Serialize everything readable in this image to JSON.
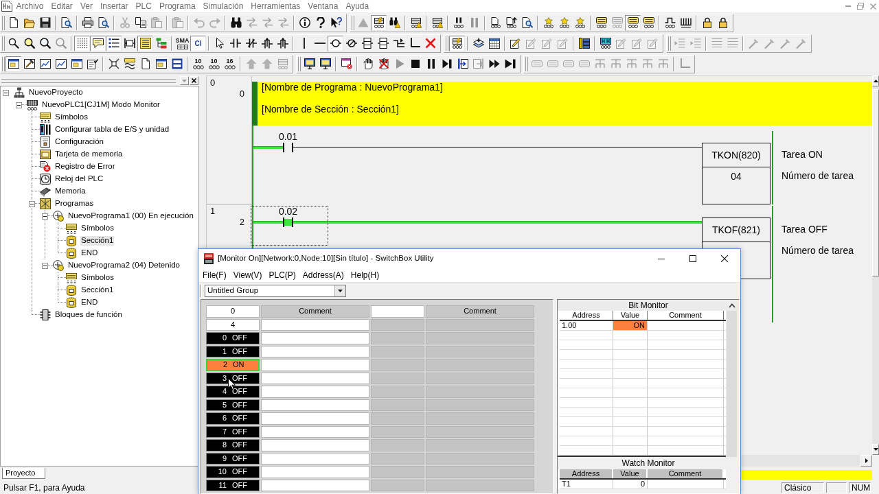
{
  "menu": [
    "Archivo",
    "Editar",
    "Ver",
    "Insertar",
    "PLC",
    "Programa",
    "Simulación",
    "Herramientas",
    "Ventana",
    "Ayuda"
  ],
  "toolbars": [
    [
      [
        [
          {
            "kind": "new",
            "disabled": false,
            "pressed": false
          },
          {
            "kind": "open",
            "disabled": false,
            "pressed": false
          },
          {
            "kind": "save",
            "disabled": false,
            "pressed": false
          }
        ],
        [
          {
            "kind": "finddoc",
            "disabled": false,
            "pressed": false
          }
        ],
        [
          {
            "kind": "print",
            "disabled": false,
            "pressed": false
          },
          {
            "kind": "finddoc",
            "disabled": false,
            "pressed": false
          }
        ],
        [
          {
            "kind": "cut",
            "disabled": true,
            "pressed": false
          },
          {
            "kind": "copy",
            "disabled": false,
            "pressed": false
          },
          {
            "kind": "paste",
            "disabled": true,
            "pressed": false
          }
        ],
        [
          {
            "kind": "paste",
            "disabled": true,
            "pressed": false
          }
        ],
        [
          {
            "kind": "undo",
            "disabled": true,
            "pressed": false
          },
          {
            "kind": "redo",
            "disabled": true,
            "pressed": false
          }
        ],
        [
          {
            "kind": "binoc",
            "disabled": false,
            "pressed": false
          },
          {
            "kind": "swap",
            "disabled": true,
            "pressed": false
          },
          {
            "kind": "swap",
            "disabled": true,
            "pressed": false
          },
          {
            "kind": "swap",
            "disabled": true,
            "pressed": false
          }
        ],
        [
          {
            "kind": "info",
            "disabled": false,
            "pressed": false
          },
          {
            "kind": "help",
            "disabled": false,
            "pressed": false
          },
          {
            "kind": "whats",
            "disabled": false,
            "pressed": false
          }
        ]
      ],
      [
        [
          {
            "kind": "tri",
            "disabled": true,
            "pressed": false
          },
          {
            "kind": "plcbolt",
            "disabled": false,
            "pressed": true
          },
          {
            "kind": "binwarn",
            "disabled": false,
            "pressed": false
          }
        ],
        [
          {
            "kind": "plcwarn",
            "disabled": false,
            "pressed": false
          }
        ],
        [
          {
            "kind": "plcwarn",
            "disabled": false,
            "pressed": false
          }
        ],
        [
          {
            "kind": "plcpause",
            "disabled": false,
            "pressed": false
          },
          {
            "kind": "pause",
            "disabled": true,
            "pressed": false
          }
        ],
        [
          {
            "kind": "plcdoc",
            "disabled": false,
            "pressed": false
          },
          {
            "kind": "upload",
            "disabled": false,
            "pressed": false
          },
          {
            "kind": "finddoc",
            "disabled": false,
            "pressed": false
          }
        ],
        [
          {
            "kind": "spark",
            "disabled": false,
            "pressed": false
          },
          {
            "kind": "spark",
            "disabled": false,
            "pressed": false
          },
          {
            "kind": "spark",
            "disabled": false,
            "pressed": false
          }
        ],
        [
          {
            "kind": "mon",
            "disabled": false,
            "pressed": false
          },
          {
            "kind": "mon",
            "disabled": true,
            "pressed": false
          },
          {
            "kind": "mon",
            "disabled": false,
            "pressed": true
          },
          {
            "kind": "mon",
            "disabled": false,
            "pressed": false
          }
        ],
        [
          {
            "kind": "wave",
            "disabled": false,
            "pressed": false
          },
          {
            "kind": "comb",
            "disabled": false,
            "pressed": false
          }
        ],
        [
          {
            "kind": "lock",
            "disabled": false,
            "pressed": false
          },
          {
            "kind": "lock",
            "disabled": false,
            "pressed": false
          }
        ]
      ]
    ],
    [
      [
        [
          {
            "kind": "magsm",
            "disabled": false,
            "pressed": false
          },
          {
            "kind": "magy",
            "disabled": false,
            "pressed": false
          },
          {
            "kind": "mag",
            "disabled": false,
            "pressed": false
          },
          {
            "kind": "mag",
            "disabled": true,
            "pressed": false
          }
        ],
        [
          {
            "kind": "grid",
            "disabled": false,
            "pressed": true
          },
          {
            "kind": "bubble",
            "disabled": false,
            "pressed": true
          },
          {
            "kind": "list",
            "disabled": false,
            "pressed": true
          },
          {
            "kind": "bracket",
            "disabled": false,
            "pressed": false
          },
          {
            "kind": "sheet",
            "disabled": false,
            "pressed": true
          },
          {
            "kind": "tree",
            "disabled": false,
            "pressed": false
          }
        ],
        [
          {
            "kind": "sma",
            "label": "SMA",
            "disabled": false,
            "pressed": false
          },
          {
            "kind": "ci",
            "label": "CI",
            "disabled": false,
            "pressed": true
          }
        ],
        [
          {
            "kind": "pointer",
            "disabled": false,
            "pressed": false
          },
          {
            "kind": "no",
            "disabled": false,
            "pressed": false
          },
          {
            "kind": "nc",
            "disabled": false,
            "pressed": false
          },
          {
            "kind": "edge",
            "disabled": false,
            "pressed": false
          },
          {
            "kind": "edge",
            "disabled": false,
            "pressed": false
          }
        ],
        [
          {
            "kind": "vline",
            "disabled": false,
            "pressed": false
          },
          {
            "kind": "hline",
            "disabled": false,
            "pressed": false
          },
          {
            "kind": "coil",
            "disabled": false,
            "pressed": true
          },
          {
            "kind": "coilnc",
            "disabled": false,
            "pressed": false
          },
          {
            "kind": "instr",
            "disabled": false,
            "pressed": false
          },
          {
            "kind": "instr",
            "disabled": false,
            "pressed": false
          },
          {
            "kind": "branch",
            "disabled": false,
            "pressed": false
          },
          {
            "kind": "corner",
            "disabled": false,
            "pressed": false
          },
          {
            "kind": "del",
            "disabled": false,
            "pressed": false
          }
        ]
      ],
      [
        [
          {
            "kind": "plcbolt",
            "disabled": false,
            "pressed": true
          }
        ],
        [
          {
            "kind": "layers",
            "disabled": false,
            "pressed": false
          },
          {
            "kind": "cal",
            "disabled": false,
            "pressed": false
          }
        ],
        [
          {
            "kind": "editbox",
            "disabled": false,
            "pressed": false
          },
          {
            "kind": "editbox",
            "disabled": true,
            "pressed": false
          },
          {
            "kind": "editbox",
            "disabled": true,
            "pressed": false
          },
          {
            "kind": "editbox",
            "disabled": true,
            "pressed": false
          }
        ],
        [
          {
            "kind": "cols",
            "disabled": false,
            "pressed": false
          }
        ],
        [
          {
            "kind": "hhplc",
            "disabled": false,
            "pressed": false
          },
          {
            "kind": "editbox",
            "disabled": true,
            "pressed": false
          },
          {
            "kind": "editbox",
            "disabled": true,
            "pressed": false
          },
          {
            "kind": "editbox",
            "disabled": true,
            "pressed": false
          }
        ]
      ],
      [
        [
          {
            "kind": "indent",
            "disabled": true,
            "pressed": false
          },
          {
            "kind": "indent",
            "disabled": true,
            "pressed": false
          }
        ],
        [
          {
            "kind": "align",
            "disabled": true,
            "pressed": false
          },
          {
            "kind": "align",
            "disabled": true,
            "pressed": false
          }
        ],
        [
          {
            "kind": "wand",
            "disabled": true,
            "pressed": false
          },
          {
            "kind": "wand",
            "disabled": true,
            "pressed": false
          },
          {
            "kind": "wand",
            "disabled": true,
            "pressed": false
          },
          {
            "kind": "wand",
            "disabled": true,
            "pressed": false
          }
        ]
      ]
    ],
    [
      [
        [
          {
            "kind": "win",
            "disabled": false,
            "pressed": true
          },
          {
            "kind": "hammer",
            "disabled": false,
            "pressed": false
          },
          {
            "kind": "chartwin",
            "disabled": false,
            "pressed": false
          },
          {
            "kind": "chartwin",
            "disabled": false,
            "pressed": false
          },
          {
            "kind": "win",
            "disabled": false,
            "pressed": false
          },
          {
            "kind": "props",
            "disabled": false,
            "pressed": false
          }
        ],
        [
          {
            "kind": "crossarr",
            "disabled": false,
            "pressed": false
          },
          {
            "kind": "cable",
            "disabled": false,
            "pressed": false
          },
          {
            "kind": "new",
            "disabled": false,
            "pressed": false
          },
          {
            "kind": "win",
            "disabled": false,
            "pressed": false
          },
          {
            "kind": "memtab",
            "disabled": false,
            "pressed": false
          }
        ],
        [
          {
            "kind": "radix",
            "label": "10",
            "disabled": false,
            "pressed": false
          },
          {
            "kind": "radix",
            "label": "10",
            "disabled": false,
            "pressed": false
          },
          {
            "kind": "radix",
            "label": "16",
            "disabled": false,
            "pressed": false
          }
        ],
        [
          {
            "kind": "arrowup",
            "disabled": true,
            "pressed": false
          },
          {
            "kind": "arrowup",
            "disabled": true,
            "pressed": false
          },
          {
            "kind": "plc",
            "disabled": true,
            "pressed": false
          }
        ]
      ],
      [
        [
          {
            "kind": "screen",
            "disabled": false,
            "pressed": false
          },
          {
            "kind": "screen",
            "disabled": false,
            "pressed": false
          }
        ],
        [
          {
            "kind": "windel",
            "disabled": false,
            "pressed": false
          }
        ],
        [
          {
            "kind": "hand",
            "disabled": false,
            "pressed": false
          },
          {
            "kind": "handx",
            "disabled": false,
            "pressed": false
          },
          {
            "kind": "play",
            "disabled": true,
            "pressed": false
          },
          {
            "kind": "stop",
            "disabled": false,
            "pressed": false
          },
          {
            "kind": "pause",
            "disabled": false,
            "pressed": false
          },
          {
            "kind": "step",
            "disabled": false,
            "pressed": false
          },
          {
            "kind": "stepin",
            "disabled": false,
            "pressed": false
          },
          {
            "kind": "stepout",
            "disabled": true,
            "pressed": false
          },
          {
            "kind": "ff",
            "disabled": false,
            "pressed": false
          },
          {
            "kind": "end",
            "disabled": false,
            "pressed": false
          }
        ]
      ],
      [
        [
          {
            "kind": "block",
            "disabled": true,
            "pressed": false
          },
          {
            "kind": "block",
            "disabled": true,
            "pressed": false
          },
          {
            "kind": "block",
            "disabled": true,
            "pressed": false
          },
          {
            "kind": "block",
            "disabled": true,
            "pressed": false
          },
          {
            "kind": "bus",
            "disabled": true,
            "pressed": false
          },
          {
            "kind": "bus",
            "disabled": true,
            "pressed": false
          },
          {
            "kind": "bus",
            "disabled": true,
            "pressed": false
          },
          {
            "kind": "bus",
            "disabled": true,
            "pressed": false
          },
          {
            "kind": "bus",
            "disabled": true,
            "pressed": false
          }
        ],
        [
          {
            "kind": "corner",
            "disabled": true,
            "pressed": false
          }
        ]
      ]
    ]
  ],
  "project_tree": {
    "nodes": [
      {
        "label": "NuevoProyecto",
        "kind": "project",
        "expanded": true,
        "selected": false,
        "children": [
          {
            "label": "NuevoPLC1[CJ1M] Modo Monitor",
            "kind": "plc",
            "expanded": true,
            "selected": false,
            "children": [
              {
                "label": "Símbolos",
                "kind": "symbols",
                "selected": false
              },
              {
                "label": "Configurar tabla de E/S y unidad",
                "kind": "io",
                "selected": false
              },
              {
                "label": "Configuración",
                "kind": "settings",
                "selected": false
              },
              {
                "label": "Tarjeta de memoria",
                "kind": "card",
                "selected": false
              },
              {
                "label": "Registro de Error",
                "kind": "errors",
                "selected": false
              },
              {
                "label": "Reloj del PLC",
                "kind": "clock",
                "selected": false
              },
              {
                "label": "Memoria",
                "kind": "memory",
                "selected": false
              },
              {
                "label": "Programas",
                "kind": "programs",
                "expanded": true,
                "selected": false,
                "children": [
                  {
                    "label": "NuevoPrograma1 (00) En ejecución",
                    "kind": "program",
                    "expanded": true,
                    "selected": false,
                    "children": [
                      {
                        "label": "Símbolos",
                        "kind": "symbols",
                        "selected": false
                      },
                      {
                        "label": "Sección1",
                        "kind": "section",
                        "selected": true
                      },
                      {
                        "label": "END",
                        "kind": "section",
                        "selected": false
                      }
                    ]
                  },
                  {
                    "label": "NuevoPrograma2 (04) Detenido",
                    "kind": "program",
                    "expanded": true,
                    "selected": false,
                    "children": [
                      {
                        "label": "Símbolos",
                        "kind": "symbols",
                        "selected": false
                      },
                      {
                        "label": "Sección1",
                        "kind": "section",
                        "selected": false
                      },
                      {
                        "label": "END",
                        "kind": "section",
                        "selected": false
                      }
                    ]
                  }
                ]
              },
              {
                "label": "Bloques de función",
                "kind": "fblocks",
                "selected": false
              }
            ]
          }
        ]
      }
    ],
    "tab": "Proyecto"
  },
  "ladder": {
    "rungs": [
      {
        "rung": "0",
        "step": "0",
        "comment": [
          "[Nombre de Programa : NuevoPrograma1]",
          "[Nombre de Sección : Sección1]"
        ],
        "selected": false,
        "contact": {
          "address": "0.01",
          "on": false
        },
        "instruction": {
          "mnemonic": "TKON(820)",
          "operand": "04"
        },
        "operand_comments": [
          "Tarea ON",
          "Número de tarea"
        ]
      },
      {
        "rung": "1",
        "step": "2",
        "selected": true,
        "contact": {
          "address": "0.02",
          "on": true
        },
        "instruction": {
          "mnemonic": "TKOF(821)"
        },
        "operand_comments": [
          "Tarea OFF",
          "Número de tarea"
        ]
      }
    ]
  },
  "status_bar": {
    "help": "Pulsar F1, para Ayuda",
    "mode": "Clásico",
    "keys": "NUM"
  },
  "switchbox": {
    "title": "[Monitor On][Network:0,Node:10][Sin título] - SwitchBox Utility",
    "menu": [
      "File(F)",
      "View(V)",
      "PLC(P)",
      "Address(A)",
      "Help(H)"
    ],
    "group": "Untitled Group",
    "channels": [
      {
        "assigned": true,
        "channel": "0",
        "comment_header": "Comment",
        "word_value": "4",
        "bits": [
          {
            "bit": "0",
            "value": "OFF",
            "on": false,
            "selected": false
          },
          {
            "bit": "1",
            "value": "OFF",
            "on": false,
            "selected": false
          },
          {
            "bit": "2",
            "value": "ON",
            "on": true,
            "selected": true
          },
          {
            "bit": "3",
            "value": "OFF",
            "on": false,
            "selected": false
          },
          {
            "bit": "4",
            "value": "OFF",
            "on": false,
            "selected": false
          },
          {
            "bit": "5",
            "value": "OFF",
            "on": false,
            "selected": false
          },
          {
            "bit": "6",
            "value": "OFF",
            "on": false,
            "selected": false
          },
          {
            "bit": "7",
            "value": "OFF",
            "on": false,
            "selected": false
          },
          {
            "bit": "8",
            "value": "OFF",
            "on": false,
            "selected": false
          },
          {
            "bit": "9",
            "value": "OFF",
            "on": false,
            "selected": false
          },
          {
            "bit": "10",
            "value": "OFF",
            "on": false,
            "selected": false
          },
          {
            "bit": "11",
            "value": "OFF",
            "on": false,
            "selected": false
          }
        ]
      },
      {
        "assigned": false,
        "comment_header": "Comment"
      }
    ],
    "bit_monitor": {
      "title": "Bit Monitor",
      "columns": [
        "Address",
        "Value",
        "Comment"
      ],
      "rows": [
        {
          "address": "1.00",
          "value": "ON",
          "on": true
        }
      ]
    },
    "watch_monitor": {
      "title": "Watch Monitor",
      "columns": [
        "Address",
        "Value",
        "Comment"
      ],
      "rows": [
        {
          "address": "T1",
          "value": "0"
        }
      ]
    }
  }
}
